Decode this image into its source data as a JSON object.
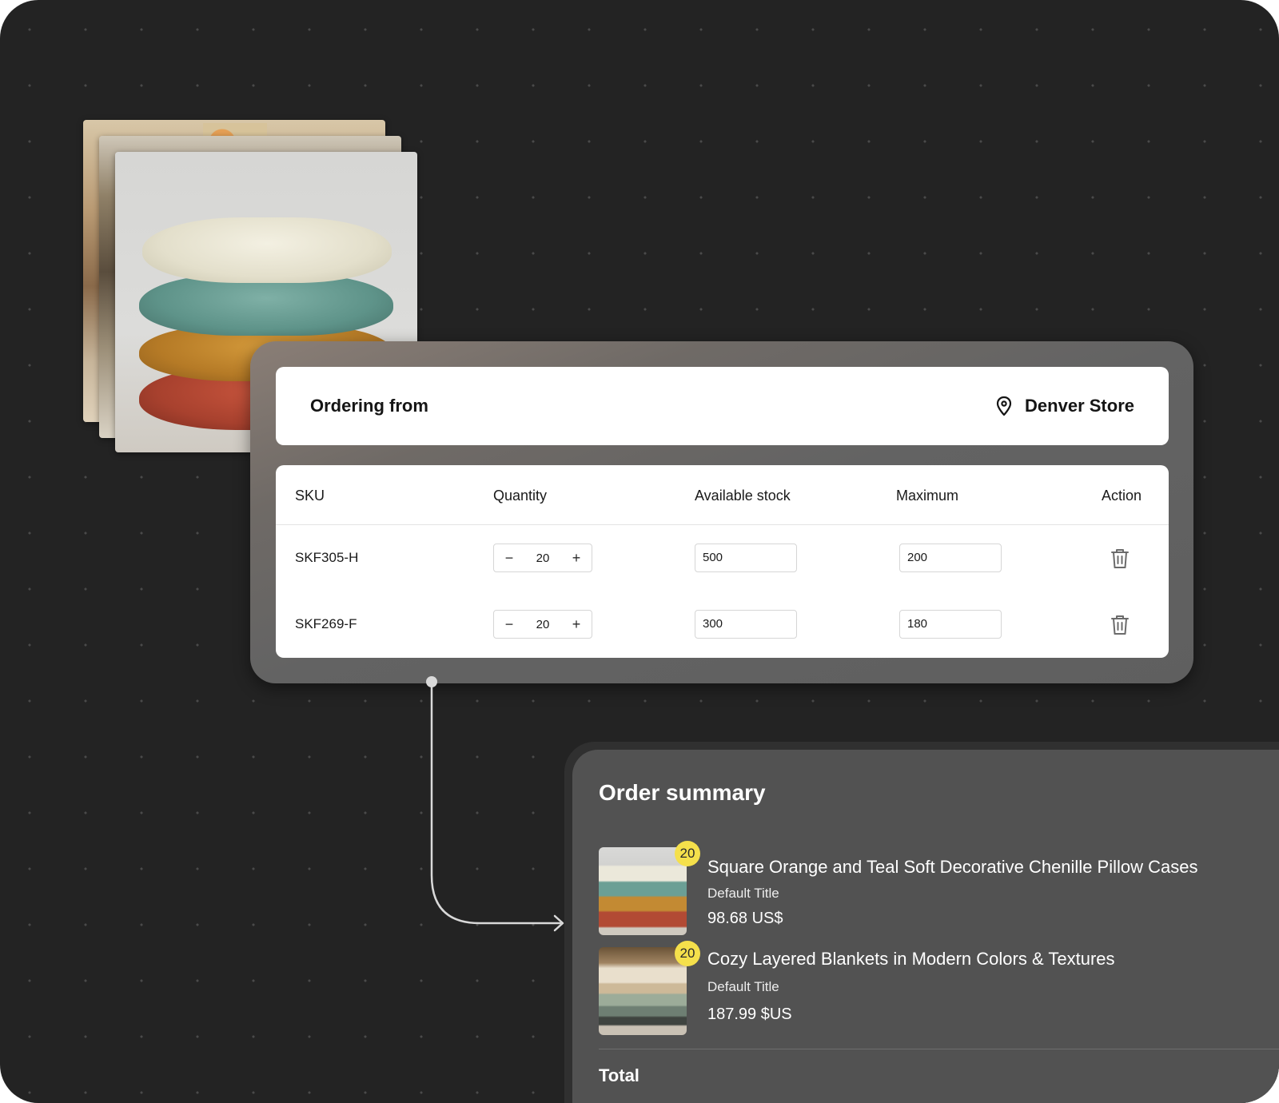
{
  "ordering": {
    "label": "Ordering from",
    "store_icon": "map-pin-icon",
    "store_name": "Denver Store"
  },
  "table": {
    "headers": {
      "sku": "SKU",
      "quantity": "Quantity",
      "stock": "Available stock",
      "maximum": "Maximum",
      "action": "Action"
    },
    "rows": [
      {
        "sku": "SKF305-H",
        "quantity": "20",
        "stock": "500",
        "maximum": "200",
        "action_icon": "trash-icon"
      },
      {
        "sku": "SKF269-F",
        "quantity": "20",
        "stock": "300",
        "maximum": "180",
        "action_icon": "trash-icon"
      }
    ],
    "decrement_symbol": "−",
    "increment_symbol": "+"
  },
  "summary": {
    "title": "Order summary",
    "items": [
      {
        "quantity_badge": "20",
        "name": "Square Orange and Teal Soft Decorative Chenille Pillow Cases",
        "variant": "Default Title",
        "price": "98.68 US$"
      },
      {
        "quantity_badge": "20",
        "name": "Cozy Layered Blankets in Modern Colors & Textures",
        "variant": "Default Title",
        "price": "187.99 $US"
      }
    ],
    "total_label": "Total"
  },
  "colors": {
    "background": "#232323",
    "badge": "#f5e04b",
    "summary_panel": "#525252",
    "card": "#ffffff"
  }
}
